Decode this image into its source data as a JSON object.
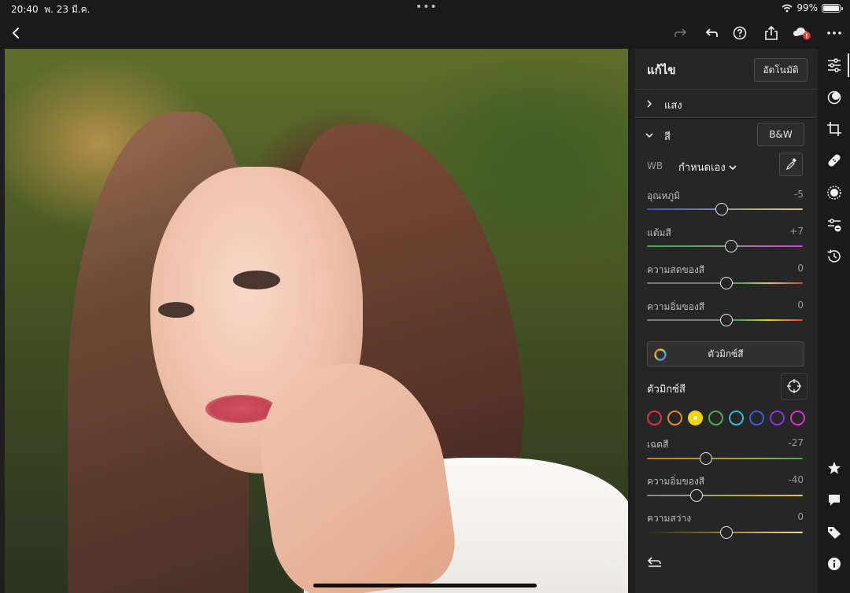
{
  "status": {
    "time": "20:40",
    "date": "พ. 23 มี.ค.",
    "battery": "99%",
    "battery_level": 0.99
  },
  "panel": {
    "title": "แก้ไข",
    "auto_button": "อัตโนมัติ",
    "light_section": "แสง",
    "color_section": "สี",
    "bw_button": "B&W",
    "wb_label": "WB",
    "wb_value": "กำหนดเอง",
    "sliders": [
      {
        "label": "อุณหภูมิ",
        "value": "-5",
        "position": 0.48
      },
      {
        "label": "แต้มสี",
        "value": "+7",
        "position": 0.54
      },
      {
        "label": "ความสดของสี",
        "value": "0",
        "position": 0.51
      },
      {
        "label": "ความอิ่มของสี",
        "value": "0",
        "position": 0.51
      }
    ],
    "mixer_button": "ตัวมิกซ์สี",
    "mixer_title": "ตัวมิกซ์สี",
    "swatches": [
      {
        "name": "red",
        "color": "#e0303b"
      },
      {
        "name": "orange",
        "color": "#e7892b"
      },
      {
        "name": "yellow",
        "color": "#f1d40d",
        "selected": true
      },
      {
        "name": "green",
        "color": "#4caf50"
      },
      {
        "name": "aqua",
        "color": "#22c1d6"
      },
      {
        "name": "blue",
        "color": "#3f5bd6"
      },
      {
        "name": "purple",
        "color": "#8e2fd6"
      },
      {
        "name": "magenta",
        "color": "#d52fd0"
      }
    ],
    "mixer_sliders": [
      {
        "label": "เฉดสี",
        "value": "-27",
        "position": 0.38
      },
      {
        "label": "ความอิ่มของสี",
        "value": "-40",
        "position": 0.32
      },
      {
        "label": "ความสว่าง",
        "value": "0",
        "position": 0.51
      }
    ]
  },
  "colors": {
    "accent": "#e6e6e6",
    "panel_bg": "#262626",
    "toolbar_bg": "#1a1a1a",
    "badge": "#e53935"
  }
}
